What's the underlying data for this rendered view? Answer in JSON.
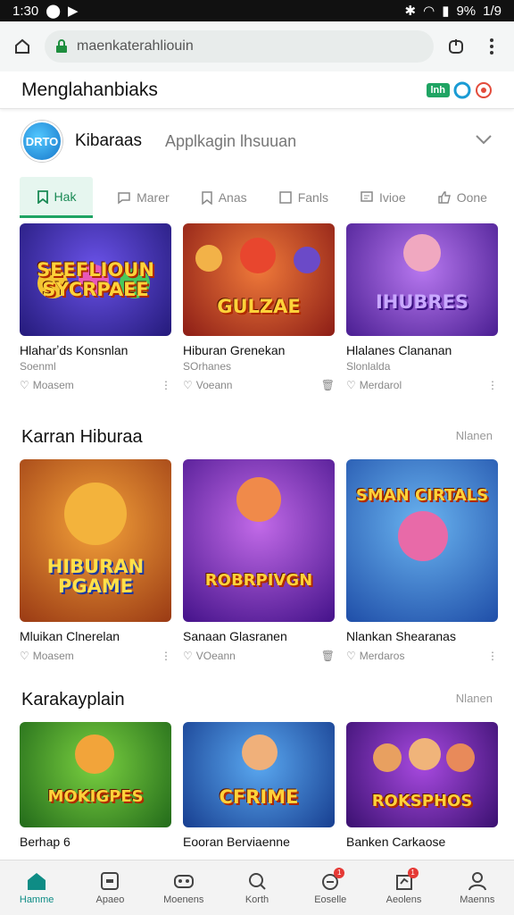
{
  "status_bar": {
    "time": "1:30",
    "battery": "9%",
    "extra": "1/9"
  },
  "browser": {
    "url": "maenkaterahliouin"
  },
  "header": {
    "title": "Menglahanbiaks",
    "badge": "lnh"
  },
  "app": {
    "name": "Kibaraas",
    "subtitle": "Applkagin lhsuuan",
    "logo_text": "DRTO"
  },
  "tabs": [
    {
      "label": "Hak",
      "icon": "bookmark-icon"
    },
    {
      "label": "Marer",
      "icon": "chat-icon"
    },
    {
      "label": "Anas",
      "icon": "tag-icon"
    },
    {
      "label": "Fanls",
      "icon": "box-icon"
    },
    {
      "label": "Ivioe",
      "icon": "message-icon"
    },
    {
      "label": "Oone",
      "icon": "thumb-icon"
    }
  ],
  "sections": [
    {
      "title": "",
      "more": "",
      "cards": [
        {
          "logo": "SEEFLIOUN SYCRPAEE",
          "title": "Hlaharʼds Konsnlan",
          "sub": "Soenml",
          "meta": "Moasem",
          "bg": "#3a2fa8"
        },
        {
          "logo": "GULZAE",
          "title": "Hiburan Grenekan",
          "sub": "SOrhanes",
          "meta": "Voeann",
          "bg": "#c8402a"
        },
        {
          "logo": "IHUBRES",
          "title": "Hlalanes Clananan",
          "sub": "Slonlalda",
          "meta": "Merdarol",
          "bg": "#7a3fc9"
        }
      ]
    },
    {
      "title": "Karran Hiburaa",
      "more": "Nlanen",
      "cards": [
        {
          "logo": "HIBURAN PGAME",
          "title": "Mluikan Clnerelan",
          "sub": "",
          "meta": "Moasem",
          "bg": "#c85a2a"
        },
        {
          "logo": "ROBRPIVGN",
          "title": "Sanaan Glasranen",
          "sub": "",
          "meta": "VOeann",
          "bg": "#8b3fc0"
        },
        {
          "logo": "SMAN CIRTALS",
          "title": "Nlankan Shearanas",
          "sub": "",
          "meta": "Merdaros",
          "bg": "#3a86d4"
        }
      ]
    },
    {
      "title": "Karakayplain",
      "more": "Nlanen",
      "cards": [
        {
          "logo": "MOKIGPES",
          "title": "Berhap 6",
          "sub": "",
          "meta": "",
          "bg": "#3aa34a"
        },
        {
          "logo": "CFRIME",
          "title": "Eooran Berviaenne",
          "sub": "",
          "meta": "",
          "bg": "#2f74c8"
        },
        {
          "logo": "ROKSPHOS",
          "title": "Banken Carkaose",
          "sub": "",
          "meta": "",
          "bg": "#6a2fa0"
        }
      ]
    }
  ],
  "bottom_nav": [
    {
      "label": "Hamme",
      "icon": "home-icon",
      "active": true,
      "badge": ""
    },
    {
      "label": "Apaeo",
      "icon": "square-icon",
      "active": false,
      "badge": ""
    },
    {
      "label": "Moenens",
      "icon": "gamepad-icon",
      "active": false,
      "badge": ""
    },
    {
      "label": "Korth",
      "icon": "search-icon",
      "active": false,
      "badge": ""
    },
    {
      "label": "Eoselle",
      "icon": "bell-icon",
      "active": false,
      "badge": "1"
    },
    {
      "label": "Aeolens",
      "icon": "upload-icon",
      "active": false,
      "badge": "1"
    },
    {
      "label": "Maenns",
      "icon": "user-icon",
      "active": false,
      "badge": ""
    }
  ],
  "colors": {
    "accent": "#1fa463",
    "nav_active": "#0e8c85",
    "notif": "#e53935"
  }
}
